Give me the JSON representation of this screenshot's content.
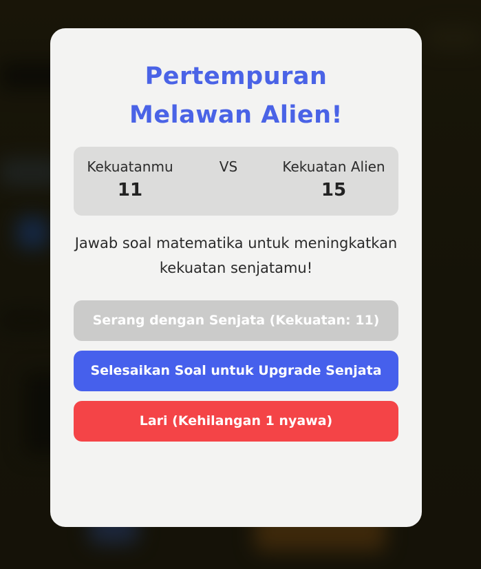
{
  "modal": {
    "title": "Pertempuran Melawan Alien!",
    "player_label": "Kekuatanmu",
    "player_power": "11",
    "vs_label": "VS",
    "alien_label": "Kekuatan Alien",
    "alien_power": "15",
    "message": "Jawab soal matematika untuk meningkatkan kekuatan senjatamu!",
    "attack_button": "Serang dengan Senjata (Kekuatan: 11)",
    "upgrade_button": "Selesaikan Soal untuk Upgrade Senjata",
    "run_button": "Lari (Kehilangan 1 nyawa)"
  },
  "colors": {
    "title": "#4a63e6",
    "attack_button": "#cbcbca",
    "upgrade_button": "#4660ec",
    "run_button": "#f44447"
  }
}
